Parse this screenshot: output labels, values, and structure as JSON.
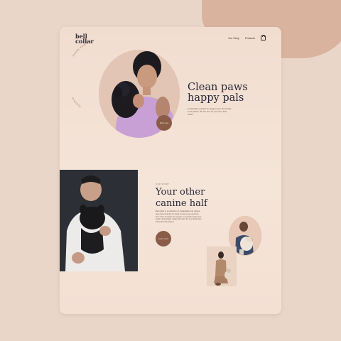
{
  "brand": {
    "logo": "bell collar"
  },
  "nav": {
    "items": [
      "Our Story",
      "Products"
    ],
    "cart_icon": "shopping-bag-icon"
  },
  "hero": {
    "arc_text": "SUSTAINABLE PRODUCTS FOR YOUR FURRY FRIENDS",
    "title": "Clean paws happy pals",
    "subtitle": "Sustainable products for doggy lovers. Be friendly to the planet. We are here for your furry best friend.",
    "button": "Shop now"
  },
  "section": {
    "eyebrow": "OUR STORY",
    "title": "Your other canine half",
    "body": "Bell collar is a collection of sustainable and natural dog care products for dogs of every age and size. Our clean formulas are gentle on sensitive skin and coats, and always made with care for your best furry friend and the planet.",
    "button": "Learn more"
  },
  "colors": {
    "background": "#e9d6c9",
    "card": "#f3e0d3",
    "accent": "#8a5c48",
    "blob": "#d9b39e",
    "heading": "#282838"
  }
}
